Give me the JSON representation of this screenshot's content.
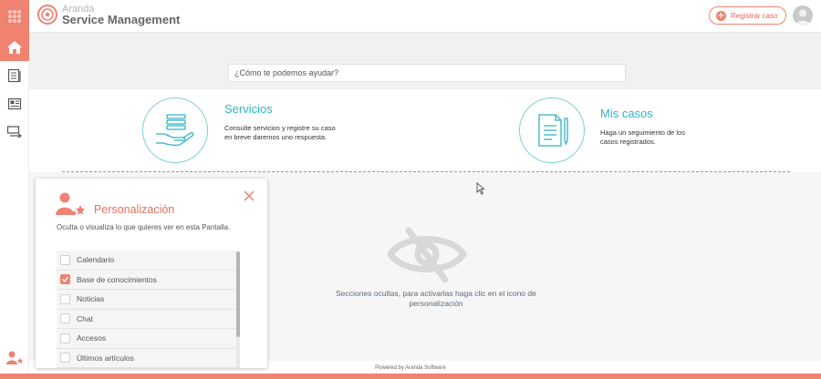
{
  "header": {
    "brand_top": "Aranda",
    "brand_bottom": "Service Management",
    "register_label": "Registrar caso"
  },
  "search": {
    "placeholder": "¿Cómo te podemos ayudar?"
  },
  "cards": [
    {
      "title": "Servicios",
      "description": "Consulte servicios y registre su caso en breve daremos uno respuesta.",
      "icon": "service-hand-icon"
    },
    {
      "title": "Mis casos",
      "description": "Haga un seguimiento de los casos registrados.",
      "icon": "document-pen-icon"
    }
  ],
  "hidden_sections": {
    "message": "Secciones ocultas, para activarlas haga clic en el icono de personalización",
    "icon": "eye-slash-icon"
  },
  "personalization": {
    "title": "Personalización",
    "description": "Oculta o visualiza lo que quieres ver en esta Pantalla.",
    "options": [
      {
        "label": "Calendario",
        "checked": false
      },
      {
        "label": "Base de conocimientos",
        "checked": true
      },
      {
        "label": "Noticias",
        "checked": false
      },
      {
        "label": "Chat",
        "checked": false
      },
      {
        "label": "Accesos",
        "checked": false
      },
      {
        "label": "Últimos artículos",
        "checked": false
      }
    ]
  },
  "footer": {
    "text": "Powered by Aranda Software"
  },
  "colors": {
    "accent": "#f08270",
    "teal": "#2fb5c3",
    "hero_bg": "#f1f1f1"
  }
}
